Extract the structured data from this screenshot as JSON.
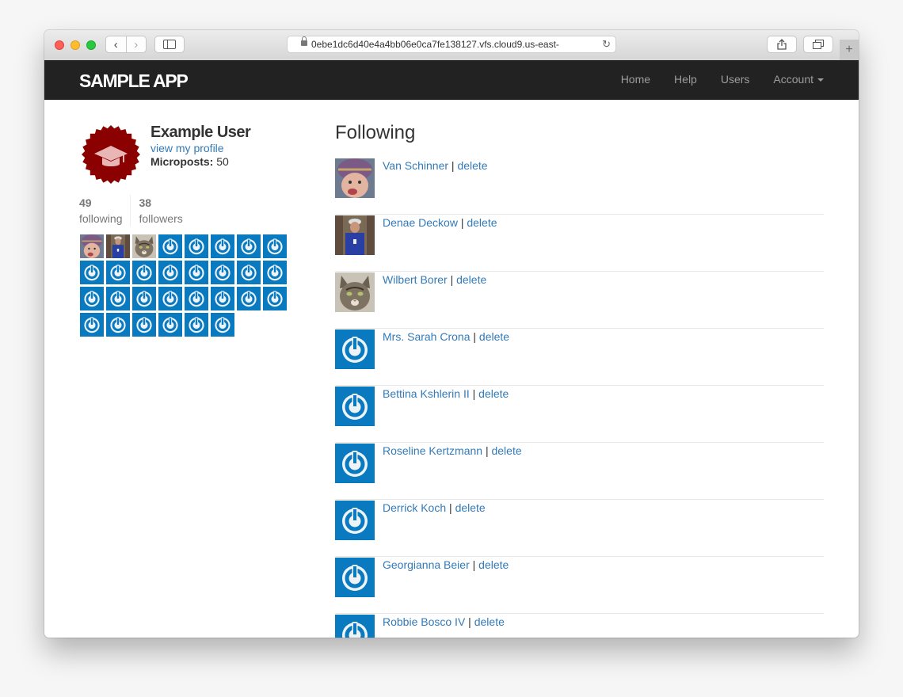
{
  "browser": {
    "url": "0ebe1dc6d40e4a4bb06e0ca7fe138127.vfs.cloud9.us-east-",
    "reload_icon": "↻",
    "new_tab_icon": "+"
  },
  "app": {
    "logo": "SAMPLE APP",
    "nav": {
      "home": "Home",
      "help": "Help",
      "users": "Users",
      "account": "Account"
    }
  },
  "profile": {
    "name": "Example User",
    "view_profile": "view my profile",
    "microposts_label": "Microposts:",
    "microposts_count": "50",
    "following_count": "49",
    "following_label": "following",
    "followers_count": "38",
    "followers_label": "followers"
  },
  "page": {
    "title": "Following"
  },
  "separator": "|",
  "delete_label": "delete",
  "following_users": [
    {
      "name": "Van Schinner",
      "avatar": "child-photo"
    },
    {
      "name": "Denae Deckow",
      "avatar": "adult-photo"
    },
    {
      "name": "Wilbert Borer",
      "avatar": "cat-photo"
    },
    {
      "name": "Mrs. Sarah Crona",
      "avatar": "default-power-icon"
    },
    {
      "name": "Bettina Kshlerin II",
      "avatar": "default-power-icon"
    },
    {
      "name": "Roseline Kertzmann",
      "avatar": "default-power-icon"
    },
    {
      "name": "Derrick Koch",
      "avatar": "default-power-icon"
    },
    {
      "name": "Georgianna Beier",
      "avatar": "default-power-icon"
    },
    {
      "name": "Robbie Bosco IV",
      "avatar": "default-power-icon"
    }
  ],
  "sidebar_grid": {
    "photo_avatars": [
      "child-photo",
      "adult-photo",
      "cat-photo"
    ],
    "default_avatar": "default-power-icon",
    "total": 30
  },
  "colors": {
    "gravatar_blue": "#0a7ac0",
    "badge_red": "#8b0000",
    "link": "#337ab7"
  }
}
